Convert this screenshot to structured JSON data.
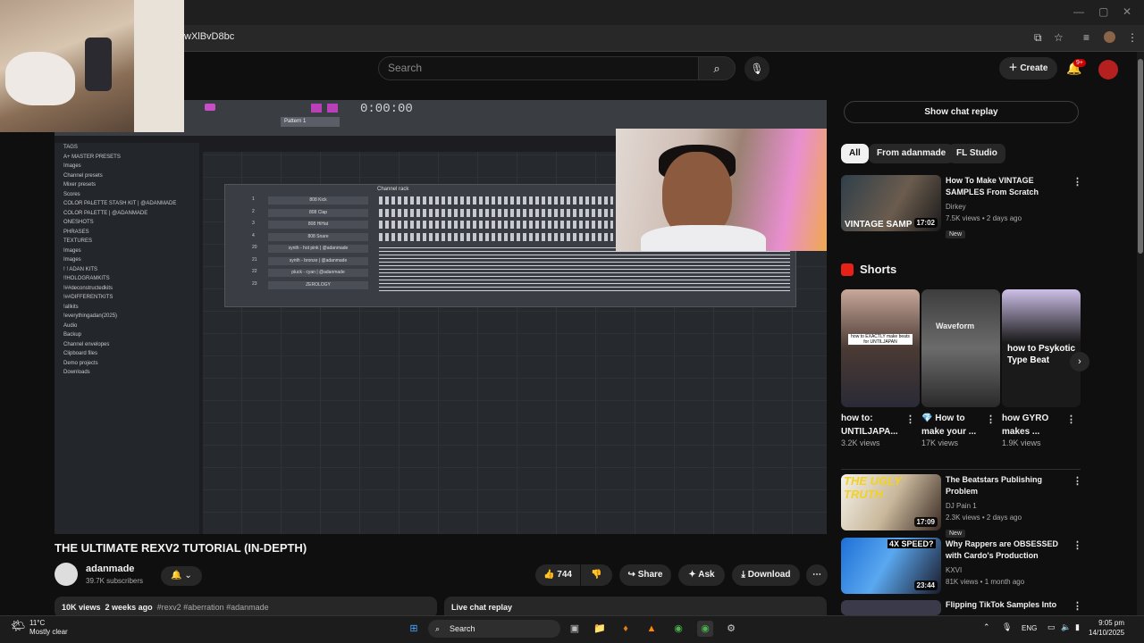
{
  "browser": {
    "url": "wXlBvD8bc"
  },
  "header": {
    "search_placeholder": "Search",
    "create_label": "Create",
    "notifications_badge": "9+"
  },
  "video": {
    "title": "THE ULTIMATE REXV2 TUTORIAL (IN-DEPTH)",
    "channel": "adanmade",
    "subscribers": "39.7K subscribers",
    "likes": "744",
    "share_label": "Share",
    "ask_label": "Ask",
    "download_label": "Download",
    "views": "10K views",
    "age": "2 weeks ago",
    "hashtags": "#rexv2 #aberration #adanmade",
    "live_chat_label": "Live chat replay"
  },
  "fl_studio": {
    "browser_items": [
      "TAGS",
      "A+ MASTER PRESETS",
      "Images",
      "Channel presets",
      "Mixer presets",
      "Scores",
      "COLOR PALETTE STASH KIT | @ADANMADE",
      "COLOR PALETTE | @ADANMADE",
      "ONESHOTS",
      "PHRASES",
      "TEXTURES",
      "Images",
      "Images",
      "! ! ADAN KITS",
      "!!HOLOGRAMKITS",
      "!##deconstructedkits",
      "!##DIFFERENTKITS",
      "!allkits",
      "!everythingadan(2025)",
      "Audio",
      "Backup",
      "Channel envelopes",
      "Clipboard files",
      "Demo projects",
      "Downloads"
    ],
    "channel_rack_title": "Channel rack",
    "channels": [
      {
        "num": "1",
        "name": "808 Kick"
      },
      {
        "num": "2",
        "name": "808 Clap"
      },
      {
        "num": "3",
        "name": "808 HiHat"
      },
      {
        "num": "4",
        "name": "808 Snare"
      },
      {
        "num": "20",
        "name": "synth - hot pink | @adanmade"
      },
      {
        "num": "21",
        "name": "synth - bronze | @adanmade"
      },
      {
        "num": "22",
        "name": "pluck - cyan | @adanmade"
      },
      {
        "num": "23",
        "name": "ZEROLOGY"
      }
    ],
    "pattern": "Pattern 1",
    "time": "0:00:00"
  },
  "sidebar": {
    "chat_replay_label": "Show chat replay",
    "chips": [
      "All",
      "From adanmade",
      "FL Studio"
    ],
    "videos_top": [
      {
        "title": "How To Make VINTAGE SAMPLES From Scratch",
        "channel": "Dirkey",
        "meta": "7.5K views • 2 days ago",
        "badge": "New",
        "duration": "17:02",
        "thumb_text": "VINTAGE SAMP"
      }
    ],
    "shorts_title": "Shorts",
    "shorts": [
      {
        "title": "how to: UNTILJAPA...",
        "views": "3.2K views",
        "caption": "how to EXACTLY make beats for UNTILJAPAN"
      },
      {
        "title": "💎 How to make your ...",
        "views": "17K views",
        "caption": "Waveform"
      },
      {
        "title": "how GYRO makes ...",
        "views": "1.9K views",
        "caption": "how to Psykotic Type Beat"
      }
    ],
    "videos_bottom": [
      {
        "title": "The Beatstars Publishing Problem",
        "channel": "DJ Pain 1",
        "meta": "2.3K views • 2 days ago",
        "badge": "New",
        "duration": "17:09",
        "thumb_text": "THE UGLY TRUTH"
      },
      {
        "title": "Why Rappers are OBSESSED with Cardo's Production",
        "channel": "KXVI",
        "meta": "81K views • 1 month ago",
        "badge": "",
        "duration": "23:44",
        "thumb_text": "4X SPEED?"
      },
      {
        "title": "Flipping TikTok Samples Into",
        "channel": "",
        "meta": "",
        "badge": "",
        "duration": "",
        "thumb_text": ""
      }
    ]
  },
  "taskbar": {
    "weather_temp": "11°C",
    "weather_desc": "Mostly clear",
    "search_label": "Search",
    "language": "ENG",
    "time": "9:05 pm",
    "date": "14/10/2025"
  },
  "colors": {
    "background": "#0f0f0f",
    "surface": "#272727",
    "accent_red": "#cc0000"
  }
}
